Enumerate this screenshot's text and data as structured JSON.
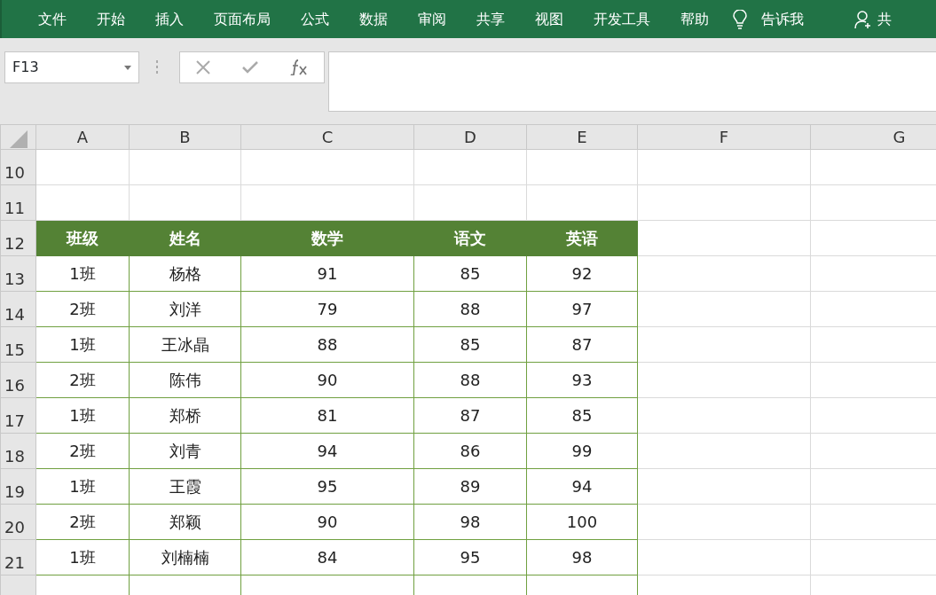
{
  "ribbon": {
    "tabs": [
      "文件",
      "开始",
      "插入",
      "页面布局",
      "公式",
      "数据",
      "审阅",
      "共享",
      "视图",
      "开发工具",
      "帮助"
    ],
    "tell_me": "告诉我",
    "share": "共"
  },
  "formula_bar": {
    "name_box": "F13"
  },
  "columns": [
    "A",
    "B",
    "C",
    "D",
    "E",
    "F",
    "G"
  ],
  "rows": [
    {
      "number": "10",
      "cells": []
    },
    {
      "number": "11",
      "cells": []
    },
    {
      "number": "12",
      "kind": "header",
      "cells": [
        "班级",
        "姓名",
        "数学",
        "语文",
        "英语"
      ]
    },
    {
      "number": "13",
      "kind": "data",
      "cells": [
        "1班",
        "杨格",
        "91",
        "85",
        "92"
      ]
    },
    {
      "number": "14",
      "kind": "data",
      "cells": [
        "2班",
        "刘洋",
        "79",
        "88",
        "97"
      ]
    },
    {
      "number": "15",
      "kind": "data",
      "cells": [
        "1班",
        "王冰晶",
        "88",
        "85",
        "87"
      ]
    },
    {
      "number": "16",
      "kind": "data",
      "cells": [
        "2班",
        "陈伟",
        "90",
        "88",
        "93"
      ]
    },
    {
      "number": "17",
      "kind": "data",
      "cells": [
        "1班",
        "郑桥",
        "81",
        "87",
        "85"
      ]
    },
    {
      "number": "18",
      "kind": "data",
      "cells": [
        "2班",
        "刘青",
        "94",
        "86",
        "99"
      ]
    },
    {
      "number": "19",
      "kind": "data",
      "cells": [
        "1班",
        "王霞",
        "95",
        "89",
        "94"
      ]
    },
    {
      "number": "20",
      "kind": "data",
      "cells": [
        "2班",
        "郑颖",
        "90",
        "98",
        "100"
      ]
    },
    {
      "number": "21",
      "kind": "data",
      "cells": [
        "1班",
        "刘楠楠",
        "84",
        "95",
        "98"
      ]
    }
  ]
}
